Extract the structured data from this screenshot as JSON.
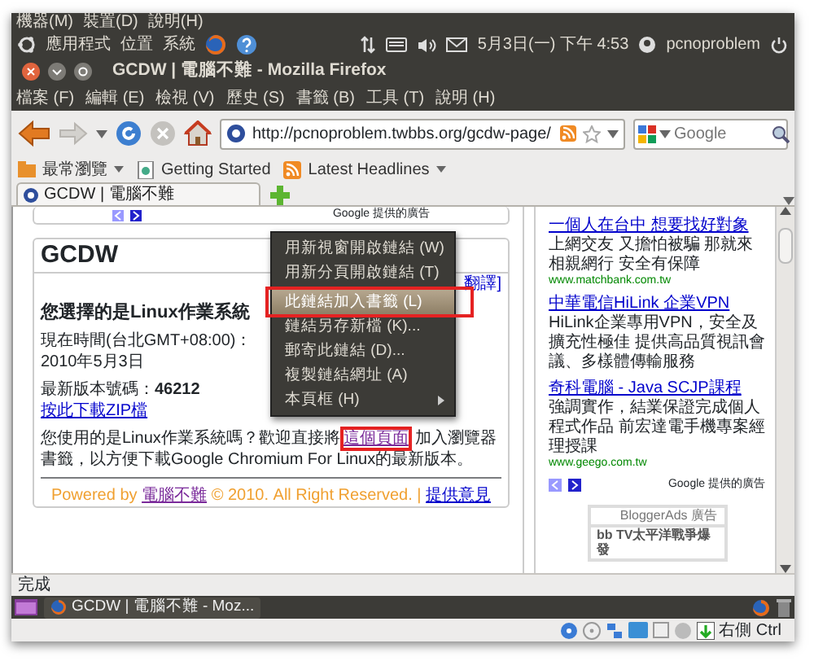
{
  "vm_menu": [
    "機器(M)",
    "裝置(D)",
    "說明(H)"
  ],
  "top_panel": {
    "menus": [
      "應用程式",
      "位置",
      "系統"
    ],
    "clock": "5月3日(一) 下午 4:53",
    "user": "pcnoproblem"
  },
  "window": {
    "title": "GCDW | 電腦不難 - Mozilla Firefox"
  },
  "menu_bar": [
    "檔案 (F)",
    "編輯 (E)",
    "檢視 (V)",
    "歷史 (S)",
    "書籤 (B)",
    "工具 (T)",
    "說明 (H)"
  ],
  "address": {
    "url": "http://pcnoproblem.twbbs.org/gcdw-page/"
  },
  "search": {
    "placeholder": "Google"
  },
  "bookmarks": [
    {
      "label": "最常瀏覽",
      "kind": "folder"
    },
    {
      "label": "Getting Started",
      "kind": "page"
    },
    {
      "label": "Latest Headlines",
      "kind": "feed"
    }
  ],
  "tabs": [
    {
      "label": "GCDW | 電腦不難",
      "selected": true
    }
  ],
  "page": {
    "top_credit": "Google 提供的廣告",
    "title": "GCDW",
    "translate": "翻譯]",
    "heading": "您選擇的是Linux作業系統",
    "time": "現在時間(台北GMT+08:00)：2010年5月3日",
    "version": "最新版本號碼：**46212**",
    "download": "按此下載ZIP檔",
    "intro": [
      {
        "kind": "text",
        "text": "您使用的是Linux作業系統嗎？歡迎直接將"
      },
      {
        "kind": "link",
        "text": "這個頁面"
      },
      {
        "kind": "text",
        "text": "加入瀏覽器書籤，以方便下載Google Chromium For Linux的最新版本。"
      }
    ],
    "footer": [
      {
        "kind": "text",
        "text": "Powered by "
      },
      {
        "kind": "link",
        "text": "電腦不難"
      },
      {
        "kind": "text",
        "text": " © 2010. All Right Reserved. | "
      },
      {
        "kind": "link",
        "text": "提供意見"
      }
    ]
  },
  "ads": [
    {
      "title": "一個人在台中 想要找好對象",
      "text": "上網交友 又擔怕被騙 那就來相親網行 安全有保障",
      "url": "www.matchbank.com.tw"
    },
    {
      "title": "中華電信HiLink 企業VPN",
      "text": "HiLink企業專用VPN，安全及擴充性極佳 提供高品質視訊會議、多樣體傳輸服務"
    },
    {
      "title": "奇科電腦 - Java SCJP課程",
      "text": "強調實作，結業保證完成個人程式作品 前宏達電手機專案經理授課",
      "url": "www.geego.com.tw"
    }
  ],
  "ad_credit": "Google 提供的廣告",
  "blogger": {
    "title": "BloggerAds 廣告",
    "item": "bb TV太平洋戰爭爆發"
  },
  "context_menu": [
    {
      "kind": "item",
      "label": "用新視窗開啟鏈結 (W)",
      "selected": false
    },
    {
      "kind": "item",
      "label": "用新分頁開啟鏈結 (T)",
      "selected": false
    },
    {
      "kind": "separator"
    },
    {
      "kind": "item",
      "label": "此鏈結加入書籤 (L)",
      "selected": true
    },
    {
      "kind": "item",
      "label": "鏈結另存新檔 (K)...",
      "selected": false
    },
    {
      "kind": "item",
      "label": "郵寄此鏈結 (D)...",
      "selected": false
    },
    {
      "kind": "item",
      "label": "複製鏈結網址 (A)",
      "selected": false
    },
    {
      "kind": "item",
      "label": "本頁框 (H)",
      "selected": false,
      "submenu": true
    }
  ],
  "status": "完成",
  "taskbar": [
    {
      "label": "GCDW | 電腦不難 - Moz...",
      "selected": false
    }
  ],
  "vbox_status": "右側 Ctrl"
}
